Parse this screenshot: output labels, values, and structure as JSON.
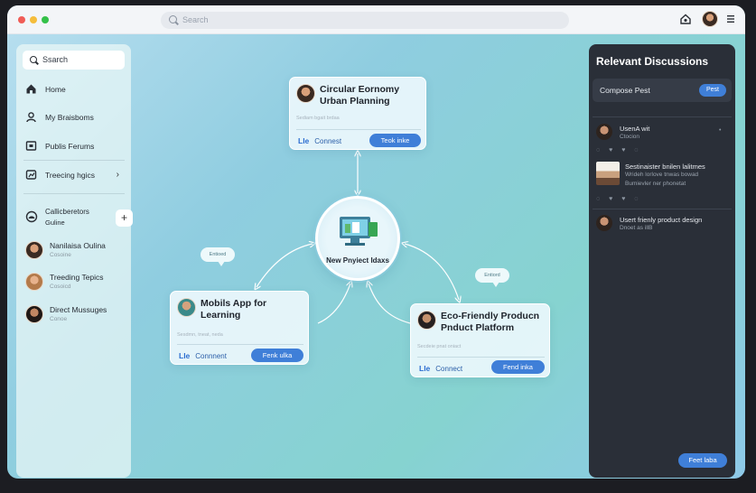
{
  "topbar": {
    "search_placeholder": "Search"
  },
  "colors": {
    "accent": "#3f7fd8",
    "panel_bg": "#2a2f38",
    "window_close": "#f05c56",
    "window_min": "#f5bd3b",
    "window_max": "#34c149"
  },
  "sidebar": {
    "search_label": "Ssarch",
    "items": [
      {
        "label": "Home",
        "icon": "home-icon"
      },
      {
        "label": "My Braisboms",
        "icon": "user-icon"
      },
      {
        "label": "Publis Ferums",
        "icon": "forum-icon"
      },
      {
        "label": "Treecing hgics",
        "icon": "trending-icon"
      }
    ],
    "collaborators": {
      "title": "Callicberetors",
      "subtitle": "Guline"
    },
    "people": [
      {
        "name": "Nanilaisa Oulina",
        "status": "Cosoine"
      },
      {
        "name": "Treeding Tepics",
        "status": "Cosoicd"
      },
      {
        "name": "Direct Mussuges",
        "status": "Conoe"
      }
    ]
  },
  "canvas": {
    "center_label": "New Pnyiect Idaxs",
    "bubbles": [
      "Entioed",
      "Entiord"
    ],
    "nodes": [
      {
        "title_line1": "Circular Eornomy",
        "title_line2": "Urban Planning",
        "subtitle": "Sediam bgait   brdaa",
        "comment_label": "Connest",
        "button_label": "Teok inke"
      },
      {
        "title_line1": "Mobils App for",
        "title_line2": "Learning",
        "subtitle": "Sesdmn, tneat,  neda",
        "comment_label": "Connnent",
        "button_label": "Fenk ulka"
      },
      {
        "title_line1": "Eco-Friendly Producn",
        "title_line2": "Pnduct Platform",
        "subtitle": "Secdeie pnat   oniact",
        "comment_label": "Connect",
        "button_label": "Fend inka"
      }
    ]
  },
  "panel": {
    "title": "Relevant Discussions",
    "compose_label": "Compose Pest",
    "compose_button": "Pest",
    "posts": [
      {
        "line1": "UsenA wit",
        "line2": "Ctocion",
        "line3": ""
      },
      {
        "line1": "Sestinaister bnilen lalitmes",
        "line2": "Wrideh lorlove tnwas bowad",
        "line3": "Bumievler ner phonetat"
      },
      {
        "line1": "Usert frienly product design",
        "line2": "Dnoet as illB",
        "line3": ""
      }
    ],
    "reactions": "◌ ♥ ♥ ◌",
    "feed_button": "Feet laba"
  }
}
